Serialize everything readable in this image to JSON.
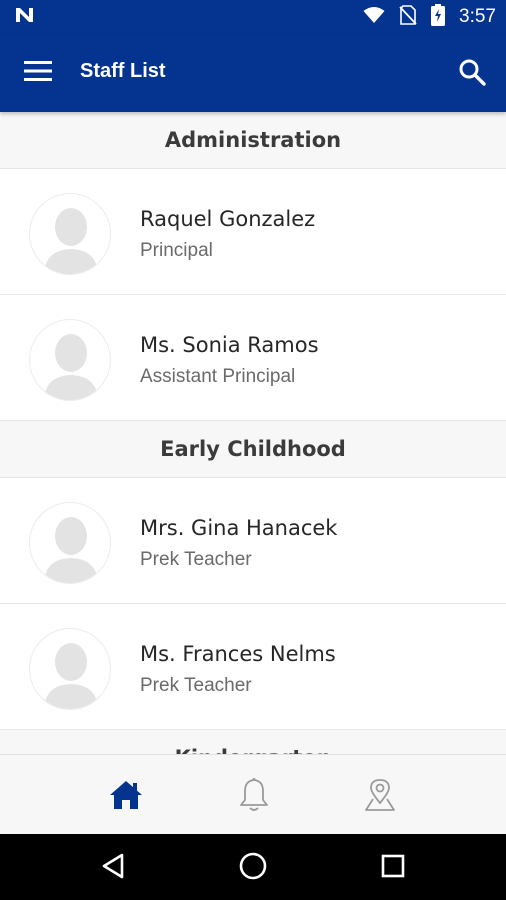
{
  "status_bar": {
    "time": "3:57",
    "icons": [
      "notification-n-icon",
      "wifi-icon",
      "no-sim-icon",
      "battery-charging-icon"
    ]
  },
  "app_bar": {
    "title": "Staff List",
    "left_icon": "menu-icon",
    "right_icon": "search-icon",
    "color": "#04348f"
  },
  "sections": [
    {
      "title": "Administration",
      "staff": [
        {
          "name": "Raquel Gonzalez",
          "role": "Principal"
        },
        {
          "name": "Ms. Sonia Ramos",
          "role": "Assistant Principal"
        }
      ]
    },
    {
      "title": "Early Childhood",
      "staff": [
        {
          "name": "Mrs. Gina Hanacek",
          "role": "Prek Teacher"
        },
        {
          "name": "Ms. Frances Nelms",
          "role": "Prek Teacher"
        }
      ]
    },
    {
      "title": "Kindergarten",
      "staff": []
    }
  ],
  "bottom_nav": {
    "items": [
      {
        "icon": "home-icon",
        "active": true
      },
      {
        "icon": "bell-icon",
        "active": false
      },
      {
        "icon": "map-pin-icon",
        "active": false
      }
    ],
    "active_color": "#04348f",
    "inactive_color": "#9a9a9a"
  },
  "system_nav": {
    "icons": [
      "back-icon",
      "home-circle-icon",
      "recents-icon"
    ]
  }
}
